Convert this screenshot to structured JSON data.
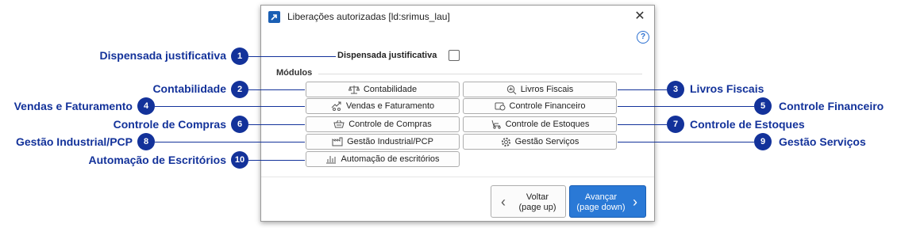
{
  "dialog": {
    "title": "Liberações autorizadas [ld:srimus_lau]",
    "dispensada_label": "Dispensada justificativa",
    "group_label": "Módulos",
    "modules": [
      {
        "label": "Contabilidade",
        "icon": "scale-icon"
      },
      {
        "label": "Livros Fiscais",
        "icon": "magnifier-chart-icon"
      },
      {
        "label": "Vendas e Faturamento",
        "icon": "sales-icon"
      },
      {
        "label": "Controle Financeiro",
        "icon": "finance-icon"
      },
      {
        "label": "Controle de Compras",
        "icon": "basket-icon"
      },
      {
        "label": "Controle de Estoques",
        "icon": "pallet-jack-icon"
      },
      {
        "label": "Gestão Industrial/PCP",
        "icon": "factory-icon"
      },
      {
        "label": "Gestão Serviços",
        "icon": "gear-icon"
      },
      {
        "label": "Automação de escritórios",
        "icon": "bar-chart-icon"
      }
    ],
    "back_line1": "Voltar",
    "back_line2": "(page up)",
    "next_line1": "Avançar",
    "next_line2": "(page down)"
  },
  "callouts": [
    {
      "num": "1",
      "label": "Dispensada justificativa"
    },
    {
      "num": "2",
      "label": "Contabilidade"
    },
    {
      "num": "3",
      "label": "Livros Fiscais"
    },
    {
      "num": "4",
      "label": "Vendas e Faturamento"
    },
    {
      "num": "5",
      "label": "Controle Financeiro"
    },
    {
      "num": "6",
      "label": "Controle de Compras"
    },
    {
      "num": "7",
      "label": "Controle de Estoques"
    },
    {
      "num": "8",
      "label": "Gestão Industrial/PCP"
    },
    {
      "num": "9",
      "label": "Gestão Serviços"
    },
    {
      "num": "10",
      "label": "Automação de Escritórios"
    }
  ],
  "colors": {
    "callout": "#13329a",
    "primary_button": "#2a79d6"
  }
}
